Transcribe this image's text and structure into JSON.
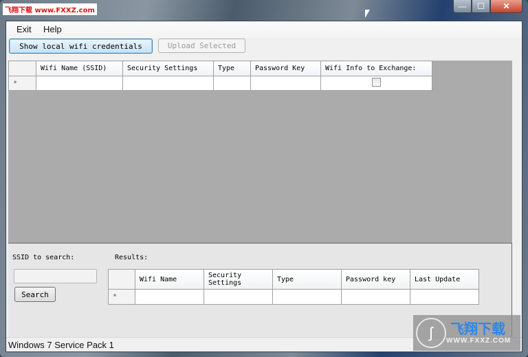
{
  "window": {
    "watermark": "飞翔下载 www.FXXZ.com",
    "caption_buttons": {
      "minimize": "—",
      "maximize": "☐",
      "close": "✕"
    }
  },
  "menu": {
    "items": [
      {
        "label": "Exit"
      },
      {
        "label": "Help"
      }
    ]
  },
  "toolbar": {
    "show_local_label": "Show local wifi credentials",
    "upload_selected_label": "Upload Selected"
  },
  "local_grid": {
    "columns": [
      "Wifi Name (SSID)",
      "Security Settings",
      "Type",
      "Password Key",
      "Wifi Info to Exchange:"
    ],
    "new_row_marker": "*",
    "exchange_checked": false
  },
  "search": {
    "ssid_label": "SSID to search:",
    "ssid_value": "",
    "search_button": "Search",
    "results_label": "Results:"
  },
  "results_grid": {
    "columns": [
      "Wifi Name",
      "Security Settings",
      "Type",
      "Password key",
      "Last Update"
    ],
    "new_row_marker": "*"
  },
  "status": {
    "text": "Windows 7 Service Pack 1"
  },
  "overlay_logo": {
    "brand": "飞翔下载",
    "url": "WWW.FXXZ.COM"
  }
}
